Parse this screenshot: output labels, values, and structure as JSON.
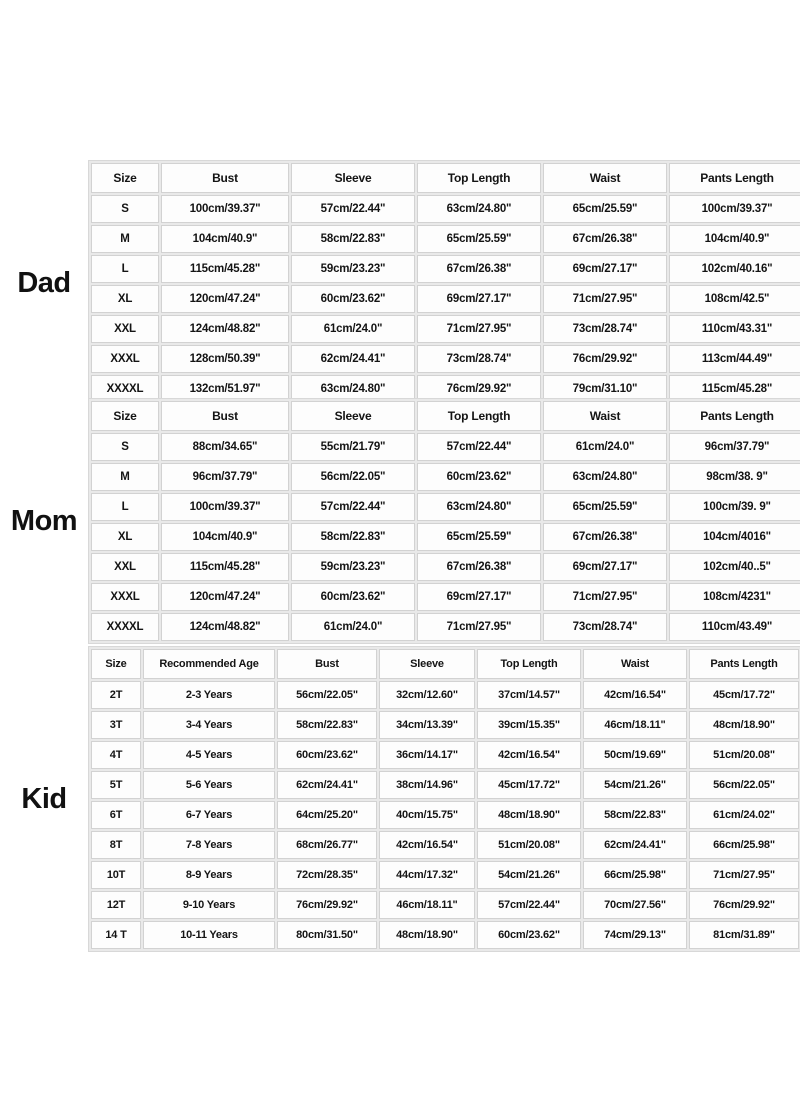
{
  "groups": [
    {
      "label": "Dad",
      "name": "dad",
      "columns": [
        "Size",
        "Bust",
        "Sleeve",
        "Top Length",
        "Waist",
        "Pants Length"
      ],
      "rows": [
        [
          "S",
          "100cm/39.37\"",
          "57cm/22.44\"",
          "63cm/24.80\"",
          "65cm/25.59\"",
          "100cm/39.37\""
        ],
        [
          "M",
          "104cm/40.9\"",
          "58cm/22.83\"",
          "65cm/25.59\"",
          "67cm/26.38\"",
          "104cm/40.9\""
        ],
        [
          "L",
          "115cm/45.28\"",
          "59cm/23.23\"",
          "67cm/26.38\"",
          "69cm/27.17\"",
          "102cm/40.16\""
        ],
        [
          "XL",
          "120cm/47.24\"",
          "60cm/23.62\"",
          "69cm/27.17\"",
          "71cm/27.95\"",
          "108cm/42.5\""
        ],
        [
          "XXL",
          "124cm/48.82\"",
          "61cm/24.0\"",
          "71cm/27.95\"",
          "73cm/28.74\"",
          "110cm/43.31\""
        ],
        [
          "XXXL",
          "128cm/50.39\"",
          "62cm/24.41\"",
          "73cm/28.74\"",
          "76cm/29.92\"",
          "113cm/44.49\""
        ],
        [
          "XXXXL",
          "132cm/51.97\"",
          "63cm/24.80\"",
          "76cm/29.92\"",
          "79cm/31.10\"",
          "115cm/45.28\""
        ]
      ]
    },
    {
      "label": "Mom",
      "name": "mom",
      "columns": [
        "Size",
        "Bust",
        "Sleeve",
        "Top Length",
        "Waist",
        "Pants Length"
      ],
      "rows": [
        [
          "S",
          "88cm/34.65\"",
          "55cm/21.79\"",
          "57cm/22.44\"",
          "61cm/24.0\"",
          "96cm/37.79\""
        ],
        [
          "M",
          "96cm/37.79\"",
          "56cm/22.05\"",
          "60cm/23.62\"",
          "63cm/24.80\"",
          "98cm/38. 9\""
        ],
        [
          "L",
          "100cm/39.37\"",
          "57cm/22.44\"",
          "63cm/24.80\"",
          "65cm/25.59\"",
          "100cm/39. 9\""
        ],
        [
          "XL",
          "104cm/40.9\"",
          "58cm/22.83\"",
          "65cm/25.59\"",
          "67cm/26.38\"",
          "104cm/4016\""
        ],
        [
          "XXL",
          "115cm/45.28\"",
          "59cm/23.23\"",
          "67cm/26.38\"",
          "69cm/27.17\"",
          "102cm/40..5\""
        ],
        [
          "XXXL",
          "120cm/47.24\"",
          "60cm/23.62\"",
          "69cm/27.17\"",
          "71cm/27.95\"",
          "108cm/4231\""
        ],
        [
          "XXXXL",
          "124cm/48.82\"",
          "61cm/24.0\"",
          "71cm/27.95\"",
          "73cm/28.74\"",
          "110cm/43.49\""
        ]
      ]
    },
    {
      "label": "Kid",
      "name": "kid",
      "columns": [
        "Size",
        "Recommended Age",
        "Bust",
        "Sleeve",
        "Top Length",
        "Waist",
        "Pants Length"
      ],
      "rows": [
        [
          "2T",
          "2-3 Years",
          "56cm/22.05\"",
          "32cm/12.60\"",
          "37cm/14.57\"",
          "42cm/16.54\"",
          "45cm/17.72\""
        ],
        [
          "3T",
          "3-4 Years",
          "58cm/22.83\"",
          "34cm/13.39\"",
          "39cm/15.35\"",
          "46cm/18.11\"",
          "48cm/18.90\""
        ],
        [
          "4T",
          "4-5 Years",
          "60cm/23.62\"",
          "36cm/14.17\"",
          "42cm/16.54\"",
          "50cm/19.69\"",
          "51cm/20.08\""
        ],
        [
          "5T",
          "5-6 Years",
          "62cm/24.41\"",
          "38cm/14.96\"",
          "45cm/17.72\"",
          "54cm/21.26\"",
          "56cm/22.05\""
        ],
        [
          "6T",
          "6-7 Years",
          "64cm/25.20\"",
          "40cm/15.75\"",
          "48cm/18.90\"",
          "58cm/22.83\"",
          "61cm/24.02\""
        ],
        [
          "8T",
          "7-8 Years",
          "68cm/26.77\"",
          "42cm/16.54\"",
          "51cm/20.08\"",
          "62cm/24.41\"",
          "66cm/25.98\""
        ],
        [
          "10T",
          "8-9 Years",
          "72cm/28.35\"",
          "44cm/17.32\"",
          "54cm/21.26\"",
          "66cm/25.98\"",
          "71cm/27.95\""
        ],
        [
          "12T",
          "9-10 Years",
          "76cm/29.92\"",
          "46cm/18.11\"",
          "57cm/22.44\"",
          "70cm/27.56\"",
          "76cm/29.92\""
        ],
        [
          "14 T",
          "10-11 Years",
          "80cm/31.50\"",
          "48cm/18.90\"",
          "60cm/23.62\"",
          "74cm/29.13\"",
          "81cm/31.89\""
        ]
      ]
    }
  ],
  "colors": {
    "background": "#ffffff",
    "cell_background": "#fdfdfd",
    "grid": "#d2d2d2",
    "gap": "#e9e9e9",
    "text": "#141414"
  }
}
